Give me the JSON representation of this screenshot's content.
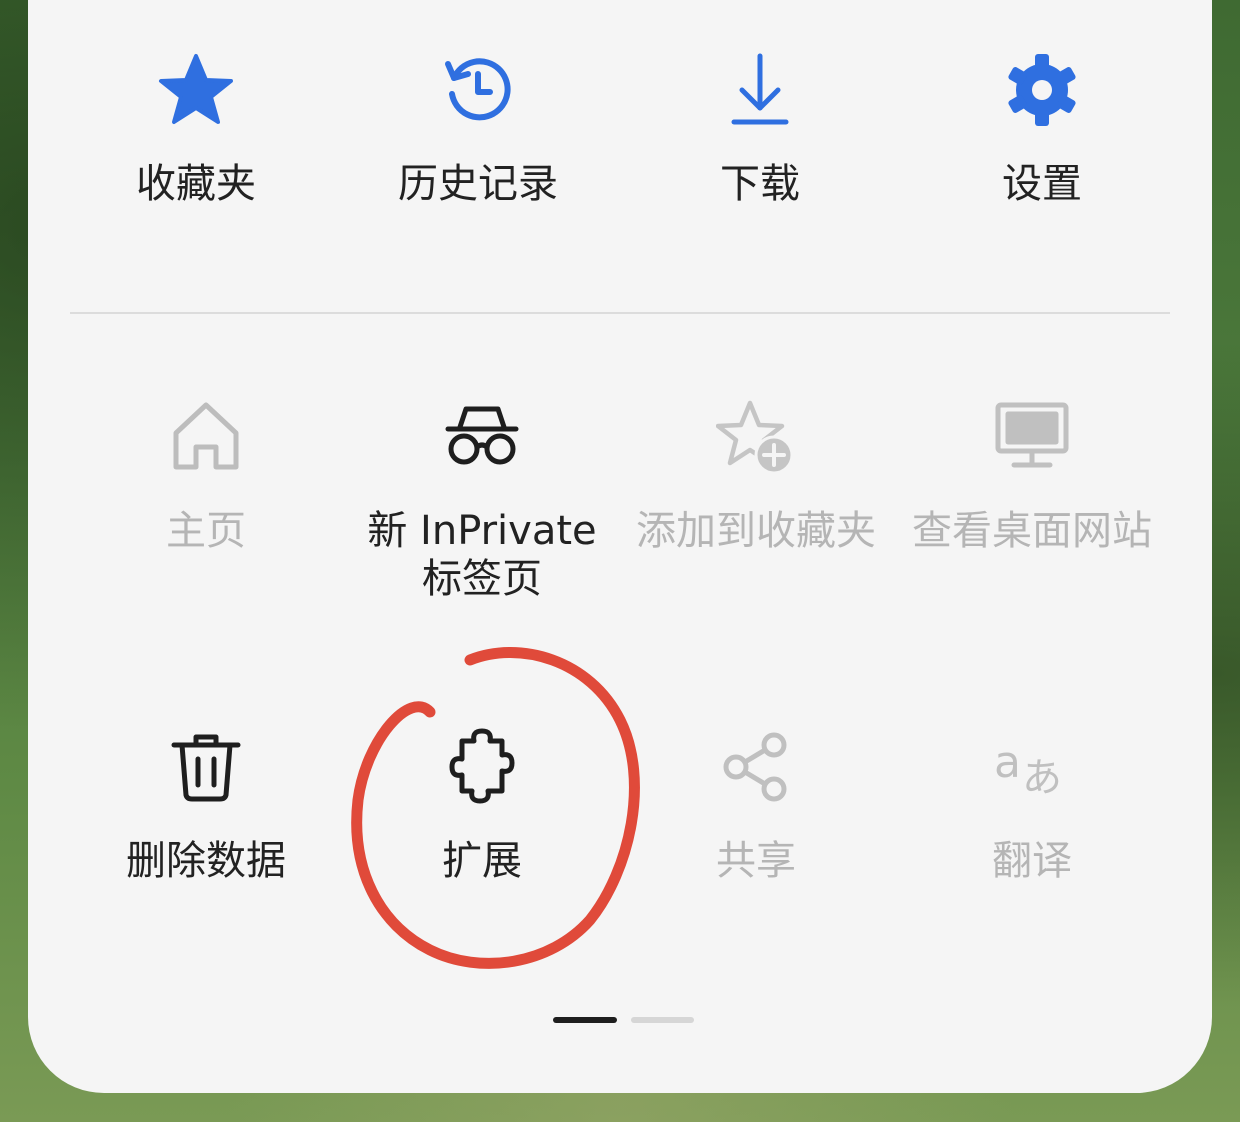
{
  "menu": {
    "row1": [
      {
        "label": "收藏夹",
        "icon": "star-icon"
      },
      {
        "label": "历史记录",
        "icon": "history-icon"
      },
      {
        "label": "下载",
        "icon": "download-icon"
      },
      {
        "label": "设置",
        "icon": "gear-icon"
      }
    ],
    "row2": [
      {
        "label": "主页",
        "icon": "home-icon",
        "enabled": false
      },
      {
        "label_line1": "新 InPrivate",
        "label_line2": "标签页",
        "icon": "inprivate-icon",
        "enabled": true
      },
      {
        "label": "添加到收藏夹",
        "icon": "star-add-icon",
        "enabled": false
      },
      {
        "label": "查看桌面网站",
        "icon": "desktop-icon",
        "enabled": false
      }
    ],
    "row3": [
      {
        "label": "删除数据",
        "icon": "trash-icon",
        "enabled": true
      },
      {
        "label": "扩展",
        "icon": "puzzle-icon",
        "enabled": true
      },
      {
        "label": "共享",
        "icon": "share-icon",
        "enabled": false
      },
      {
        "label": "翻译",
        "icon": "translate-icon",
        "enabled": false
      }
    ]
  },
  "pager": {
    "pages": 2,
    "current": 1
  },
  "colors": {
    "accent": "#2f6fe0",
    "annotation": "#e04a3a",
    "text": "#222222",
    "disabled": "#b5b5b5"
  }
}
